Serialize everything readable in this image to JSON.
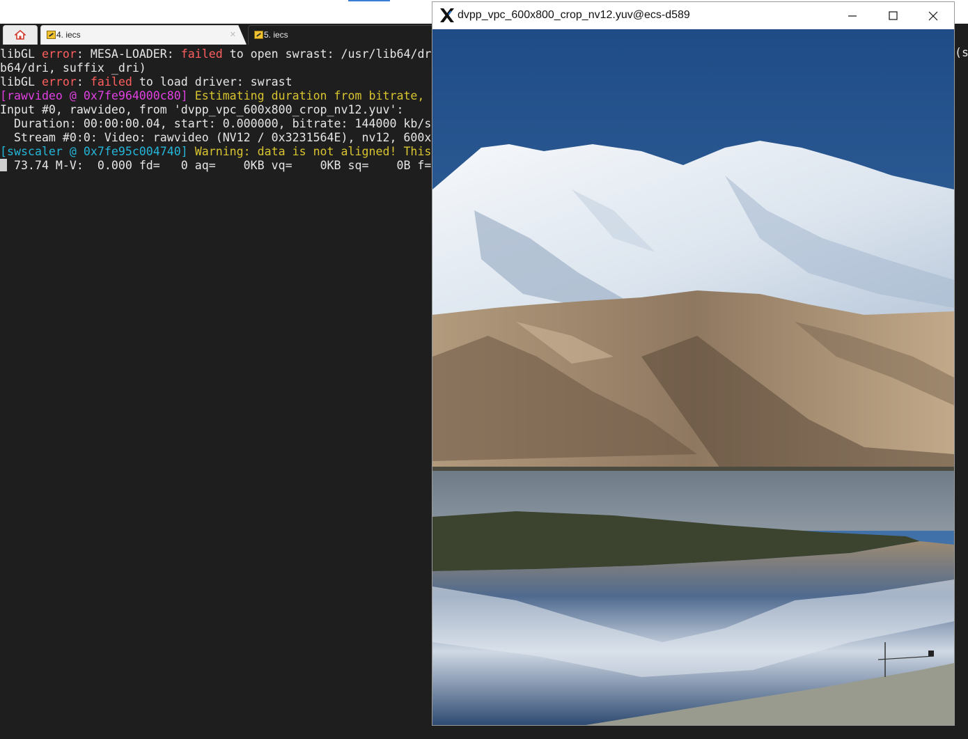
{
  "tabs": [
    {
      "label": ""
    },
    {
      "label": "4. iecs"
    },
    {
      "label": "5. iecs"
    }
  ],
  "terminal": {
    "lines": [
      [
        {
          "t": "libGL ",
          "c": ""
        },
        {
          "t": "error",
          "c": "red"
        },
        {
          "t": ": MESA-LOADER: ",
          "c": ""
        },
        {
          "t": "failed",
          "c": "red"
        },
        {
          "t": " to open swrast: /usr/lib64/dr",
          "c": ""
        }
      ],
      [
        {
          "t": "b64/dri, suffix _dri)",
          "c": ""
        }
      ],
      [
        {
          "t": "libGL ",
          "c": ""
        },
        {
          "t": "error",
          "c": "red"
        },
        {
          "t": ": ",
          "c": ""
        },
        {
          "t": "failed",
          "c": "red"
        },
        {
          "t": " to load driver: swrast",
          "c": ""
        }
      ],
      [
        {
          "t": "[rawvideo @ 0x7fe964000c80] ",
          "c": "mag"
        },
        {
          "t": "Estimating duration from bitrate,",
          "c": "yel"
        }
      ],
      [
        {
          "t": "Input #0, rawvideo, from 'dvpp_vpc_600x800_crop_nv12.yuv':",
          "c": ""
        }
      ],
      [
        {
          "t": "  Duration: 00:00:00.04, start: 0.000000, bitrate: 144000 kb/s",
          "c": ""
        }
      ],
      [
        {
          "t": "  Stream #0:0: Video: rawvideo (NV12 / 0x3231564E), nv12, 600x",
          "c": ""
        }
      ],
      [
        {
          "t": "[swscaler @ 0x7fe95c004740] ",
          "c": "cyan"
        },
        {
          "t": "Warning: data is not aligned! This",
          "c": "yel"
        }
      ],
      [
        {
          "t": "__CURSOR__",
          "c": "cursor"
        },
        {
          "t": " 73.74 M-V:  0.000 fd=   0 aq=    0KB vq=    0KB sq=    0B f=",
          "c": ""
        }
      ]
    ],
    "edge_text": "(s"
  },
  "window": {
    "title": "dvpp_vpc_600x800_crop_nv12.yuv@ecs-d589",
    "minimize": "minimize",
    "maximize": "maximize",
    "close": "close"
  },
  "colors": {
    "terminal_bg": "#1e1e1e",
    "red": "#ff5f5f",
    "magenta": "#e040e0",
    "yellow": "#d8c430",
    "cyan": "#25b5d8"
  }
}
